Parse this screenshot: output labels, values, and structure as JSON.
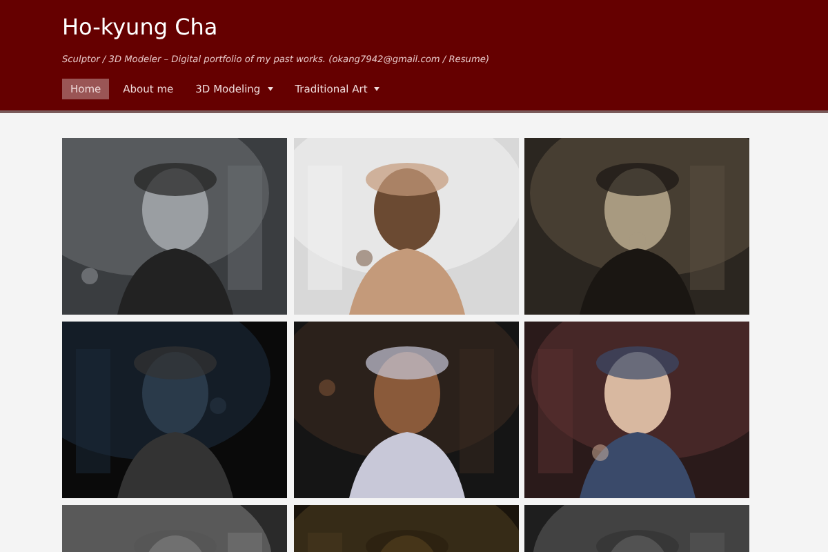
{
  "site": {
    "title": "Ho-kyung Cha",
    "tagline": "Sculptor / 3D Modeler – Digital portfolio of my past works. (okang7942@gmail.com / Resume)"
  },
  "menu": [
    {
      "label": "Home",
      "selected": true,
      "dropdown": false
    },
    {
      "label": "About me",
      "selected": false,
      "dropdown": false
    },
    {
      "label": "3D Modeling",
      "selected": false,
      "dropdown": true
    },
    {
      "label": "Traditional Art",
      "selected": false,
      "dropdown": true
    }
  ]
}
